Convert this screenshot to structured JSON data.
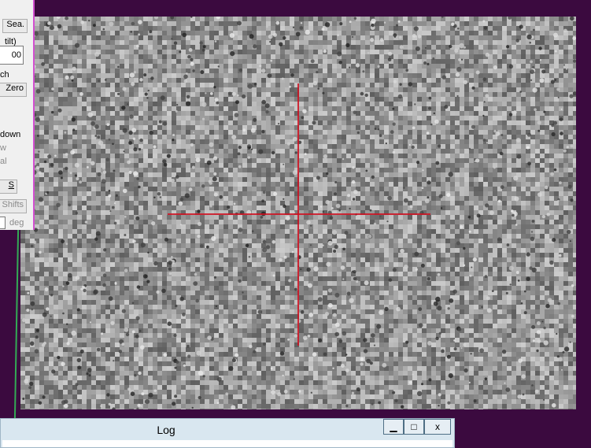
{
  "panel": {
    "sea_button": "Sea.",
    "label_tilt": "tilt)",
    "value_field": "00",
    "label_ch": "ch",
    "zero_button": "Zero",
    "label_down": "down",
    "label_w": "w",
    "label_al": "al",
    "s_button": "S",
    "shifts_button": "Shifts",
    "deg_label": "deg"
  },
  "log": {
    "title": "Log",
    "minimize": "▁",
    "maximize": "□",
    "close": "x"
  },
  "colors": {
    "background": "#3b0a3f",
    "crosshair": "#d01020",
    "panel_border": "#d24fd0"
  }
}
